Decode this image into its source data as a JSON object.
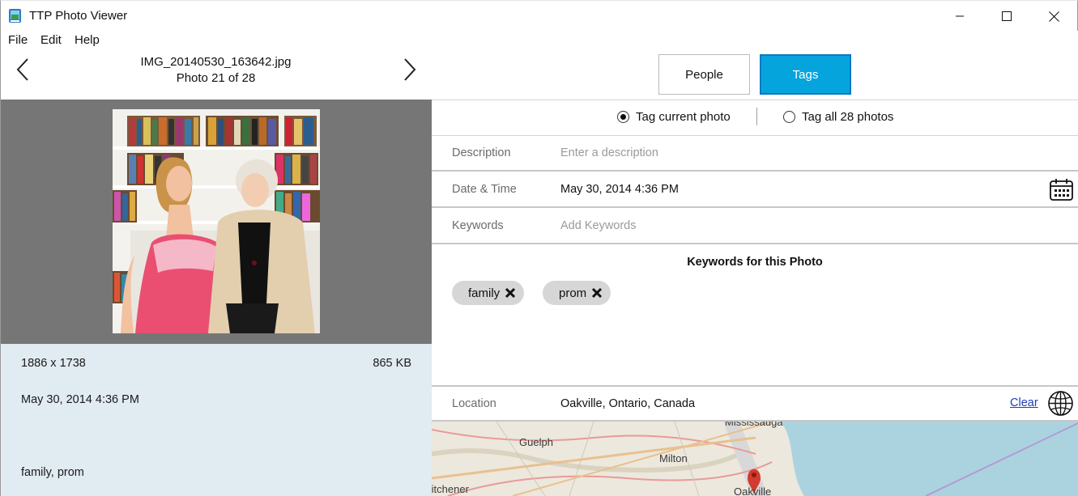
{
  "window": {
    "title": "TTP Photo Viewer",
    "icon": "app-photo-icon"
  },
  "menu": [
    "File",
    "Edit",
    "Help"
  ],
  "photo_nav": {
    "file_name": "IMG_20140530_163642.jpg",
    "counter": "Photo 21 of 28"
  },
  "photo_info": {
    "dimensions": "1886 x 1738",
    "file_size": "865 KB",
    "date": "May 30, 2014 4:36 PM",
    "keywords": "family, prom"
  },
  "tabs": {
    "people": "People",
    "tags": "Tags",
    "active": "Tags"
  },
  "scope": {
    "current_label": "Tag current photo",
    "all_label": "Tag all 28 photos",
    "selected": "current"
  },
  "fields": {
    "description": {
      "label": "Description",
      "placeholder": "Enter a description",
      "value": ""
    },
    "datetime": {
      "label": "Date & Time",
      "value": "May 30, 2014 4:36 PM"
    },
    "keywords": {
      "label": "Keywords",
      "placeholder": "Add Keywords",
      "value": ""
    },
    "location": {
      "label": "Location",
      "value": "Oakville, Ontario, Canada",
      "clear_label": "Clear"
    }
  },
  "keywords_panel": {
    "heading": "Keywords for this Photo",
    "chips": [
      "family",
      "prom"
    ]
  },
  "map": {
    "labels": [
      "Mississauga",
      "Guelph",
      "Milton",
      "Kitchener",
      "Oakville"
    ],
    "marker_color": "#d23b2f",
    "water_color": "#aad3df"
  },
  "colors": {
    "accent": "#06a4dd",
    "photo_pane_bg": "#767676",
    "info_pane_bg": "#e1ebf2"
  }
}
